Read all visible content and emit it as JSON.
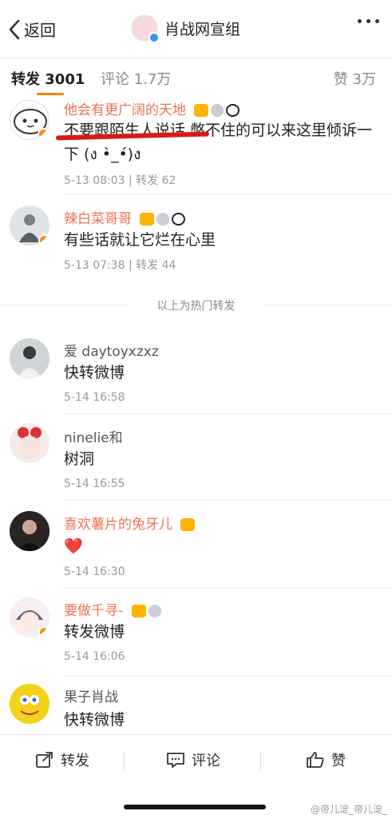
{
  "nav": {
    "back_label": "返回",
    "title": "肖战网宣组",
    "more_icon": "more-dots-icon"
  },
  "tabs": {
    "repost": "转发 3001",
    "comment": "评论 1.7万",
    "like": "赞 3万"
  },
  "hot_reposts": [
    {
      "name": "他会有更广阔的天地",
      "content": "不要跟陌生人说话  憋不住的可以来这里倾诉一下 (ง •̀_•́)ง",
      "meta": "5-13 08:03 | 转发 62"
    },
    {
      "name": "辣白菜哥哥",
      "content": "有些话就让它烂在心里",
      "meta": "5-13 07:38 | 转发 44"
    }
  ],
  "hot_divider": "以上为热门转发",
  "reposts": [
    {
      "name": "爱 daytoyxzxz",
      "content": "快转微博",
      "meta": "5-14 16:58"
    },
    {
      "name": "ninelie和",
      "content": "树洞",
      "meta": "5-14 16:55"
    },
    {
      "name": "喜欢薯片的兔牙儿",
      "content": "❤️",
      "meta": "5-14 16:30"
    },
    {
      "name": "要做千寻-",
      "content": "转发微博",
      "meta": "5-14 16:06"
    },
    {
      "name": "果子肖战",
      "content": "快转微博",
      "meta": ""
    }
  ],
  "bottom": {
    "repost": "转发",
    "comment": "评论",
    "like": "赞"
  },
  "watermark": "@帝儿淀_帝儿淀_",
  "colors": {
    "accent": "#ff8200",
    "username_orange": "#eb7350",
    "highlight_red": "#d61a1a"
  }
}
